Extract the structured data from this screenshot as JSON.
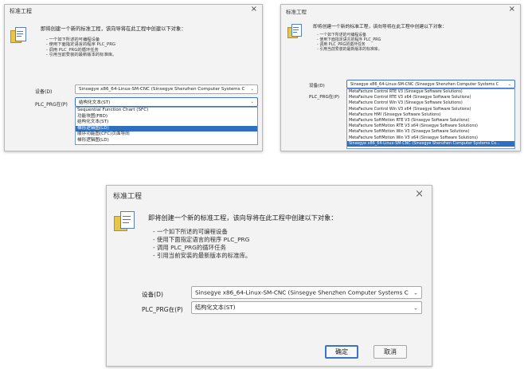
{
  "dialog_title": "标准工程",
  "heading": "即将创建一个新的标准工程，该向导将在此工程中创建以下对象：",
  "bullets": [
    "- 一个如下所述的可编程设备",
    "- 使用下面指定语言的程序 PLC_PRG",
    "- 调用 PLC_PRG的循环任务",
    "- 引用当前安装的最新版本的标准库。"
  ],
  "device_label": "设备(D)",
  "device_value": "Sinsegye x86_64-Linux-SM-CNC (Sinsegye Shenzhen Computer Systems C",
  "plc_label": "PLC_PRG在(P)",
  "plc_value": "结构化文本(ST)",
  "lang_options": [
    "Sequential Function Chart (SFC)",
    "功能块图(FBD)",
    "结构化文本(ST)",
    "梯形逻辑图(LD)",
    "顺序功能图(CFC)页面导向",
    "梯形逻辑图(LD)"
  ],
  "lang_selected_index": 3,
  "device_options": [
    "MetaFacture Control RTE V3 (Sinsegye Software Solutions)",
    "MetaFacture Control RTE V3 x64 (Sinsegye Software Solutions)",
    "MetaFacture Control Win V3 (Sinsegye Software Solutions)",
    "MetaFacture Control Win V3 x64 (Sinsegye Software Solutions)",
    "MetaFacture HMI (Sinsegye Software Solutions)",
    "MetaFacture SoftMotion RTE V3 (Sinsegye Software Solutions)",
    "MetaFacture SoftMotion RTE V3 x64 (Sinsegye Software Solutions)",
    "MetaFacture SoftMotion Win V3 (Sinsegye Software Solutions)",
    "MetaFacture SoftMotion Win V3 x64 (Sinsegye Software Solutions)",
    "Sinsegye x86_64-Linux-SM-CNC (Sinsegye Shenzhen Computer Systems Co..."
  ],
  "device_selected_index": 9,
  "ok_label": "确定",
  "cancel_label": "取消",
  "close_glyph": "×",
  "chevron_glyph": "⌄"
}
